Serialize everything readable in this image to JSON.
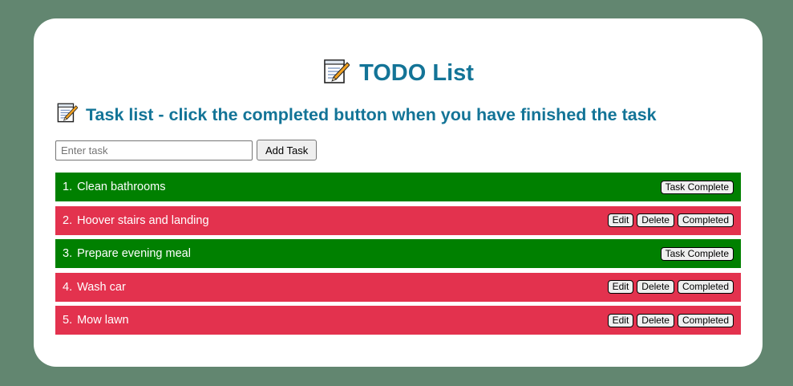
{
  "app": {
    "title": "TODO List",
    "subtitle": "Task list - click the completed button when you have finished the task",
    "title_icon": "memo-icon"
  },
  "add_task": {
    "placeholder": "Enter task",
    "value": "",
    "button_label": "Add Task"
  },
  "buttons": {
    "edit": "Edit",
    "delete": "Delete",
    "completed": "Completed",
    "task_complete": "Task Complete"
  },
  "colors": {
    "background": "#628670",
    "heading": "#137497",
    "completed_row": "#008000",
    "pending_row": "#e3324e"
  },
  "tasks": [
    {
      "number": "1.",
      "text": "Clean bathrooms",
      "status": "complete"
    },
    {
      "number": "2.",
      "text": "Hoover stairs and landing",
      "status": "pending"
    },
    {
      "number": "3.",
      "text": "Prepare evening meal",
      "status": "complete"
    },
    {
      "number": "4.",
      "text": "Wash car",
      "status": "pending"
    },
    {
      "number": "5.",
      "text": "Mow lawn",
      "status": "pending"
    }
  ]
}
